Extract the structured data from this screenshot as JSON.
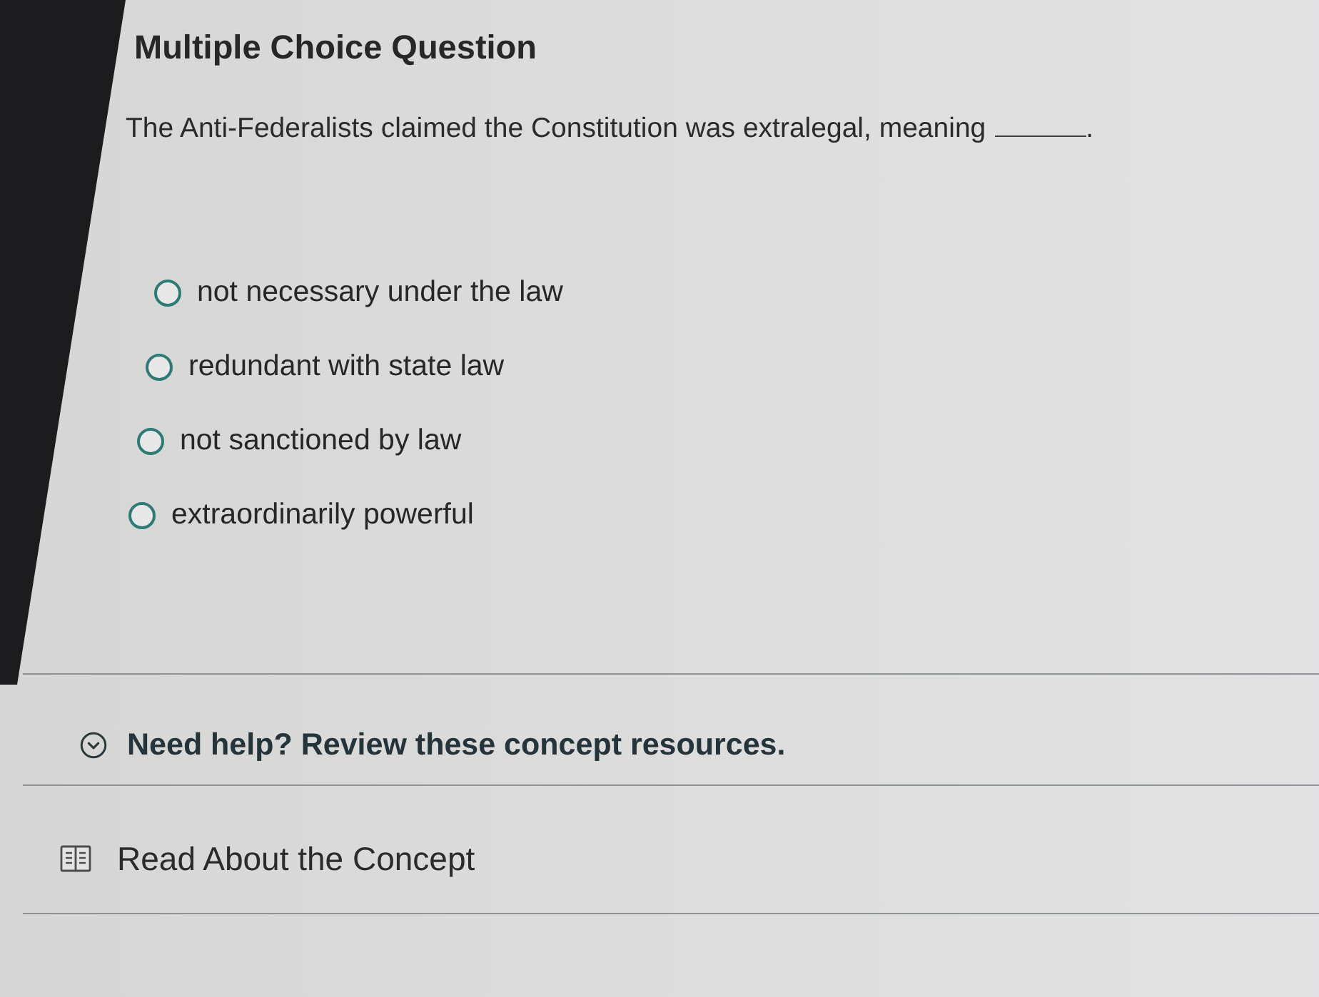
{
  "header": {
    "title": "Multiple Choice Question"
  },
  "question": {
    "parts": [
      {
        "kind": "text",
        "text": "The Anti-Federalists claimed the Constitution was extralegal, meaning"
      },
      {
        "kind": "blank"
      },
      {
        "kind": "text",
        "text": "."
      }
    ]
  },
  "options": [
    {
      "label": "not necessary under the law",
      "selected": false
    },
    {
      "label": "redundant with state law",
      "selected": false
    },
    {
      "label": "not sanctioned by law",
      "selected": false
    },
    {
      "label": "extraordinarily powerful",
      "selected": false
    }
  ],
  "help": {
    "title": "Need help? Review these concept resources.",
    "expanded": true,
    "resources": [
      {
        "label": "Read About the Concept"
      }
    ]
  }
}
